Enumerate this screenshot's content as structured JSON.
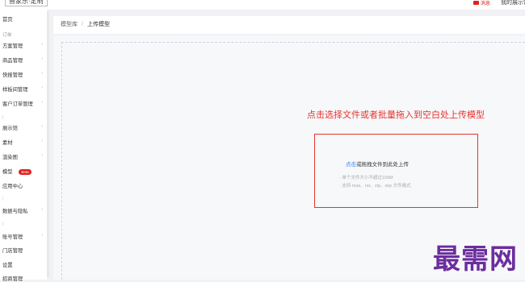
{
  "header": {
    "brand": "晋家乐·定制",
    "mail_label": "消息",
    "user_link": "我的展示馆"
  },
  "sidebar": {
    "items": [
      {
        "label": "首页",
        "kind": "item"
      },
      {
        "label": "订单",
        "kind": "group"
      },
      {
        "label": "方案管理",
        "kind": "expand"
      },
      {
        "label": "商品管理",
        "kind": "expand"
      },
      {
        "label": "快报管理",
        "kind": "expand"
      },
      {
        "label": "样板间管理",
        "kind": "expand"
      },
      {
        "label": "客户订单管理",
        "kind": "expand"
      },
      {
        "label": "展示馆",
        "kind": "expand"
      },
      {
        "label": "素材",
        "kind": "expand"
      },
      {
        "label": "渲染图",
        "kind": "expand"
      },
      {
        "label": "模型",
        "kind": "item",
        "badge": "Beta"
      },
      {
        "label": "应用中心",
        "kind": "item"
      },
      {
        "label": "数据与隐私",
        "kind": "expand"
      },
      {
        "label": "账号管理",
        "kind": "expand"
      },
      {
        "label": "门店管理",
        "kind": "item"
      },
      {
        "label": "设置",
        "kind": "item"
      },
      {
        "label": "招商管理",
        "kind": "item"
      }
    ]
  },
  "breadcrumb": {
    "root": "模型库",
    "separator": "/",
    "current": "上传模型"
  },
  "main": {
    "instruction": "点击选择文件或者批量拖入到空白处上传模型",
    "upload": {
      "link_text": "点击",
      "rest_text": "或拖拽文件到此处上传",
      "tip1": "· 单个文件大小不超过100M",
      "tip2": "· 支持 max、rar、zip、skp 文件格式"
    }
  },
  "watermark": "最需网",
  "colors": {
    "accent_red": "#e8332f",
    "link_blue": "#2d7ff9",
    "watermark_purple": "#6b2d9e",
    "background": "#f0f2f5"
  }
}
